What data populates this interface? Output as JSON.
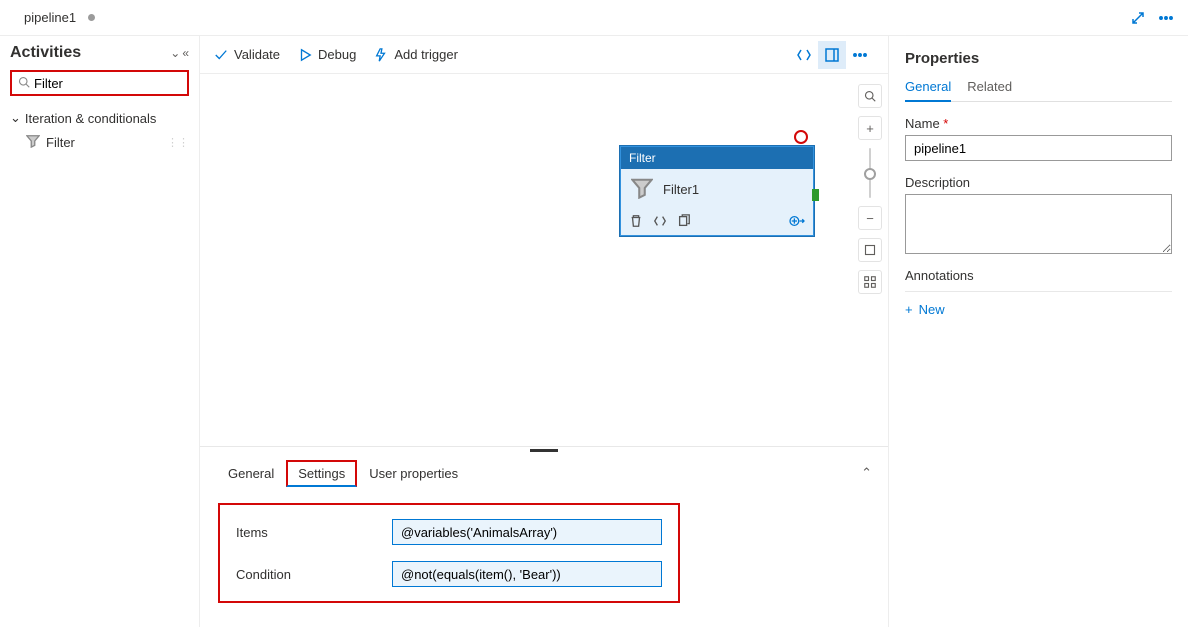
{
  "tab": {
    "title": "pipeline1"
  },
  "side_panel": {
    "title": "Activities",
    "search_value": "Filter",
    "category": "Iteration & conditionals",
    "items": [
      {
        "label": "Filter"
      }
    ]
  },
  "toolbar": {
    "validate": "Validate",
    "debug": "Debug",
    "add_trigger": "Add trigger"
  },
  "canvas": {
    "node": {
      "type_label": "Filter",
      "name": "Filter1"
    }
  },
  "bottom_panel": {
    "tabs": {
      "general": "General",
      "settings": "Settings",
      "user_props": "User properties"
    },
    "rows": {
      "items_label": "Items",
      "items_value": "@variables('AnimalsArray')",
      "condition_label": "Condition",
      "condition_value": "@not(equals(item(), 'Bear'))"
    }
  },
  "properties": {
    "title": "Properties",
    "tabs": {
      "general": "General",
      "related": "Related"
    },
    "name_label": "Name",
    "name_value": "pipeline1",
    "desc_label": "Description",
    "desc_value": "",
    "annotations_label": "Annotations",
    "new_label": "New"
  }
}
